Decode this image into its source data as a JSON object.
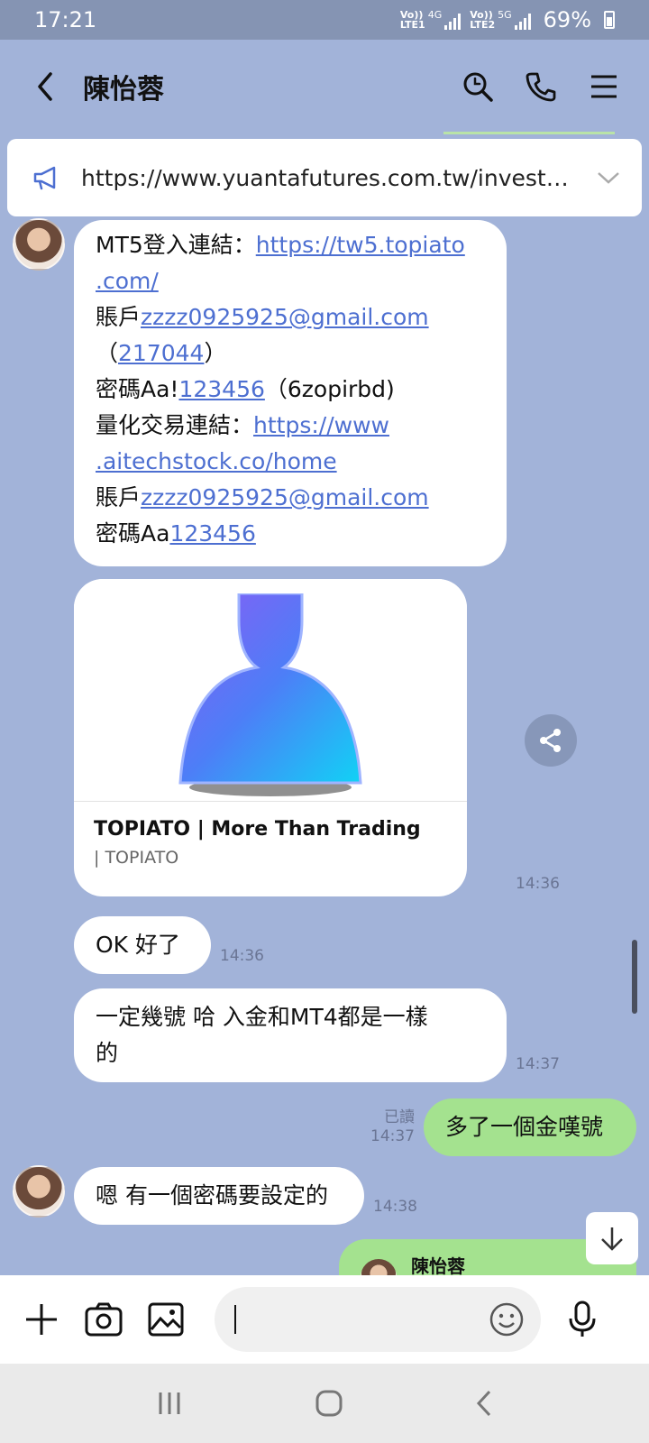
{
  "status_bar": {
    "time": "17:21",
    "sim1_top": "Vo))",
    "sim1_net": "4G",
    "sim1_bottom": "LTE1",
    "sim2_top": "Vo))",
    "sim2_net": "5G",
    "sim2_bottom": "LTE2",
    "battery": "69%"
  },
  "header": {
    "title": "陳怡蓉",
    "icons": [
      "back-icon",
      "search-icon",
      "phone-icon",
      "menu-icon"
    ]
  },
  "announcement": {
    "url": "https://www.yuantafutures.com.tw/investm..."
  },
  "messages": {
    "m1": {
      "l1_text": "MT5登入連結：",
      "l1_link": "https://tw5.topiato",
      "l2_link": ".com/",
      "l3_text": "賬戶",
      "l3_link": "zzzz0925925@gmail.com",
      "l4_pre": "（",
      "l4_link": "217044",
      "l4_post": "）",
      "l5_text": "密碼Aa!",
      "l5_link": "123456",
      "l5_post": "（6zopirbd)",
      "l6_text": "量化交易連結：",
      "l6_link": "https://www",
      "l7_link": ".aitechstock.co/home",
      "l8_text": "賬戶",
      "l8_link": "zzzz0925925@gmail.com",
      "l9_text": "密碼Aa",
      "l9_link": "123456"
    },
    "card": {
      "title": "TOPIATO | More Than Trading",
      "subtitle": "| TOPIATO",
      "time": "14:36"
    },
    "m3": {
      "text": "OK  好了",
      "time": "14:36"
    },
    "m4": {
      "l1": "一定幾號 哈    入金和MT4都是一樣",
      "l2": "的",
      "time": "14:37"
    },
    "m5": {
      "text": "多了一個金嘆號",
      "read": "已讀",
      "time": "14:37"
    },
    "m6": {
      "text": "嗯 有一個密碼要設定的",
      "time": "14:38"
    },
    "m7": {
      "quote_name": "陳怡蓉"
    }
  },
  "input_bar": {
    "placeholder": "",
    "icons": [
      "plus-icon",
      "camera-icon",
      "image-icon",
      "emoji-icon",
      "mic-icon"
    ]
  },
  "colors": {
    "chat_background": "#a2b3d9",
    "outgoing_bubble": "#a4e28f",
    "link": "#4d6fd1"
  }
}
